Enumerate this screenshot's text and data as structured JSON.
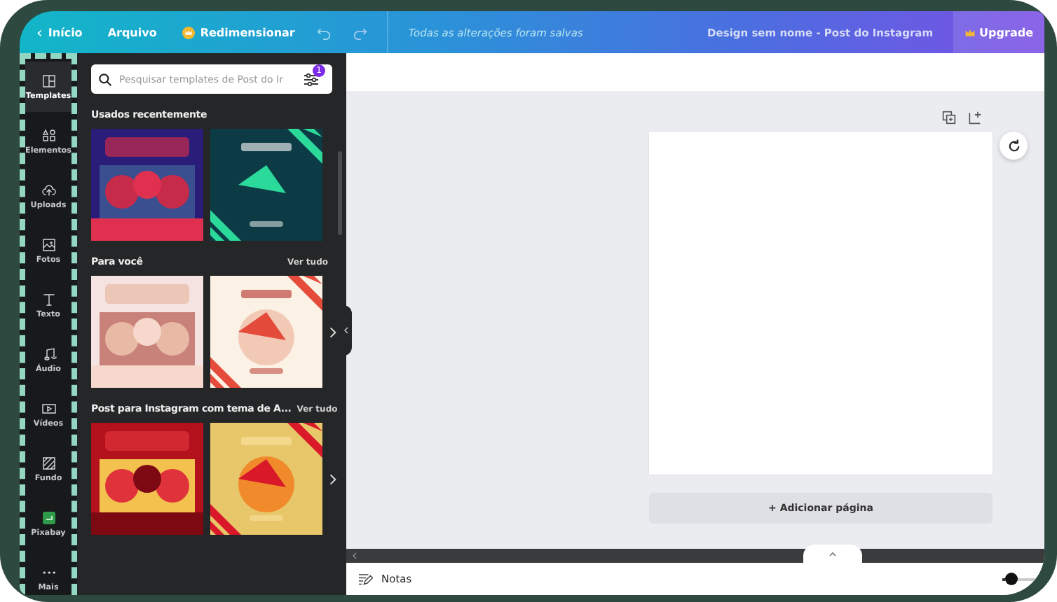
{
  "top_bar": {
    "back": "‹",
    "home": "Início",
    "file": "Arquivo",
    "resize": "Redimensionar",
    "save_status": "Todas as alterações foram salvas",
    "design_title": "Design sem nome - Post do Instagram",
    "upgrade": "Upgrade"
  },
  "rail": [
    {
      "label": "Templates",
      "selected": true
    },
    {
      "label": "Elementos",
      "selected": false
    },
    {
      "label": "Uploads",
      "selected": false
    },
    {
      "label": "Fotos",
      "selected": false
    },
    {
      "label": "Texto",
      "selected": false
    },
    {
      "label": "Áudio",
      "selected": false
    },
    {
      "label": "Vídeos",
      "selected": false
    },
    {
      "label": "Fundo",
      "selected": false
    },
    {
      "label": "Pixabay",
      "selected": false
    },
    {
      "label": "Mais",
      "selected": false
    }
  ],
  "panel": {
    "search": {
      "placeholder": "Pesquisar templates de Post do Ir"
    },
    "filter_badge": "1",
    "sections": [
      {
        "title": "Usados recentemente",
        "scrollable": false
      },
      {
        "title": "Para você",
        "see_all": "Ver tudo",
        "scrollable": true
      },
      {
        "title": "Post para Instagram com tema de A...",
        "see_all": "Ver tudo",
        "scrollable": true
      }
    ]
  },
  "canvas": {
    "add_page": "+ Adicionar página"
  },
  "notes_bar": {
    "notes": "Notas",
    "zoom": {
      "level": 0.1
    }
  }
}
